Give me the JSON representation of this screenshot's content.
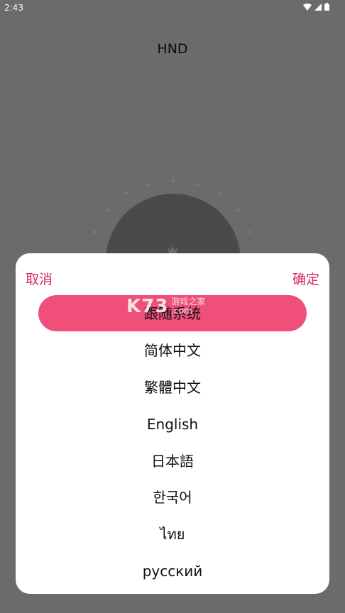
{
  "status_bar": {
    "time": "2:43"
  },
  "header": {
    "title": "HND"
  },
  "dialog": {
    "cancel_label": "取消",
    "confirm_label": "确定",
    "options": [
      "跟随系统",
      "简体中文",
      "繁體中文",
      "English",
      "日本語",
      "한국어",
      "ไทย",
      "русский"
    ],
    "selected_index": 0
  },
  "watermark": {
    "logo": "K73",
    "site_name": "游戏之家",
    "domain": ".com"
  },
  "colors": {
    "accent": "#d4285f",
    "highlight": "#ef4f79",
    "scrim": "#6b6b6b"
  }
}
